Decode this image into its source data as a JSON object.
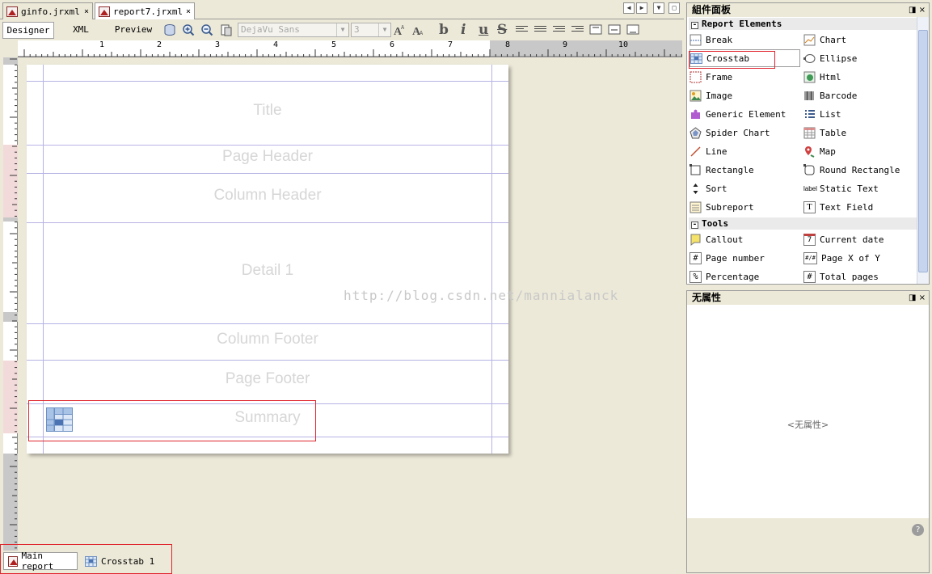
{
  "tabs": [
    {
      "label": "ginfo.jrxml",
      "close": "×"
    },
    {
      "label": "report7.jrxml",
      "close": "×"
    }
  ],
  "view_tabs": [
    "Designer",
    "XML",
    "Preview"
  ],
  "toolbar": {
    "font_family": "DejaVu Sans",
    "font_size": "3",
    "format_buttons": [
      "b",
      "i",
      "u",
      "S"
    ]
  },
  "ruler": {
    "ticks": [
      "1",
      "2",
      "3",
      "4",
      "5",
      "6",
      "7",
      "8",
      "9",
      "10"
    ]
  },
  "report_bands": [
    "Title",
    "Page Header",
    "Column Header",
    "Detail 1",
    "Column Footer",
    "Page Footer",
    "Summary"
  ],
  "watermark": "http://blog.csdn.net/mannialanck",
  "bottom_tabs": [
    "Main report",
    "Crosstab 1"
  ],
  "palette": {
    "title": "組件面板",
    "controls": "◨ ×",
    "categories": [
      {
        "name": "Report Elements",
        "items": [
          "Break",
          "Chart",
          "Crosstab",
          "Ellipse",
          "Frame",
          "Html",
          "Image",
          "Barcode",
          "Generic Element",
          "List",
          "Spider Chart",
          "Table",
          "Line",
          "Map",
          "Rectangle",
          "Round Rectangle",
          "Sort",
          "Static Text",
          "Subreport",
          "Text Field"
        ]
      },
      {
        "name": "Tools",
        "items": [
          "Callout",
          "Current date",
          "Page number",
          "Page X of Y",
          "Percentage",
          "Total pages"
        ]
      }
    ]
  },
  "properties": {
    "title": "无属性",
    "controls": "◨ ×",
    "empty_text": "<无属性>",
    "help": "?"
  },
  "icons": {
    "static_text_label": "label",
    "current_date_label": "7",
    "page_x_label": "#/#",
    "page_number_label": "#",
    "percentage_label": "%",
    "total_pages_label": "#",
    "text_field_label": "T"
  }
}
